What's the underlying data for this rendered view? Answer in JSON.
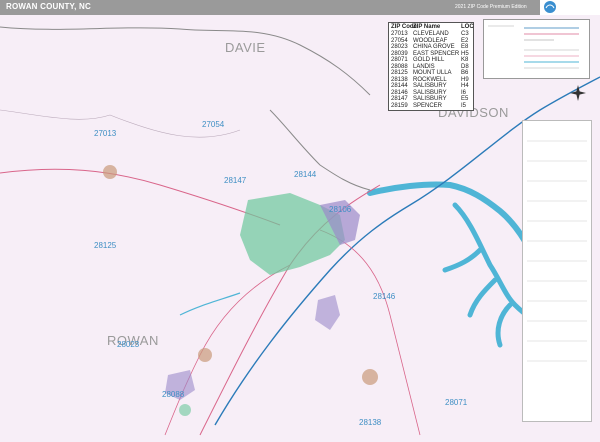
{
  "header": {
    "title": "ROWAN COUNTY, NC",
    "edition": "2021 ZIP Code Premium Edition"
  },
  "counties": {
    "davie": "DAVIE",
    "davidson": "DAVIDSON",
    "rowan": "ROWAN"
  },
  "zip_labels": [
    "27013",
    "27054",
    "28147",
    "28144",
    "28106",
    "28125",
    "28146",
    "28023",
    "28088",
    "28071",
    "28138"
  ],
  "zip_table": {
    "headers": [
      "ZIP Code",
      "ZIP Name",
      "LOC"
    ],
    "rows": [
      [
        "27013",
        "CLEVELAND",
        "C3"
      ],
      [
        "27054",
        "WOODLEAF",
        "E2"
      ],
      [
        "28023",
        "CHINA GROVE",
        "E8"
      ],
      [
        "28039",
        "EAST SPENCER",
        "H5"
      ],
      [
        "28071",
        "GOLD HILL",
        "K8"
      ],
      [
        "28088",
        "LANDIS",
        "D8"
      ],
      [
        "28125",
        "MOUNT ULLA",
        "B6"
      ],
      [
        "28138",
        "ROCKWELL",
        "H9"
      ],
      [
        "28144",
        "SALISBURY",
        "H4"
      ],
      [
        "28146",
        "SALISBURY",
        "I6"
      ],
      [
        "28147",
        "SALISBURY",
        "E5"
      ],
      [
        "28159",
        "SPENCER",
        "I5"
      ]
    ]
  },
  "colors": {
    "background": "#f7eef7",
    "water": "#4fb5d6",
    "zip_label": "#3f8fc4",
    "county_label": "#9a9a9a",
    "header": "#9a9a9a",
    "county_line": "#8a8a8a",
    "highway": "#2b7bb9",
    "major_road": "#d9658a",
    "city_green": "#6bc89b",
    "city_purple": "#9b8ac9",
    "city_brown": "#c99a7a"
  },
  "icons": {
    "compass": "compass-rose-icon",
    "logo": "map-sales-logo"
  }
}
